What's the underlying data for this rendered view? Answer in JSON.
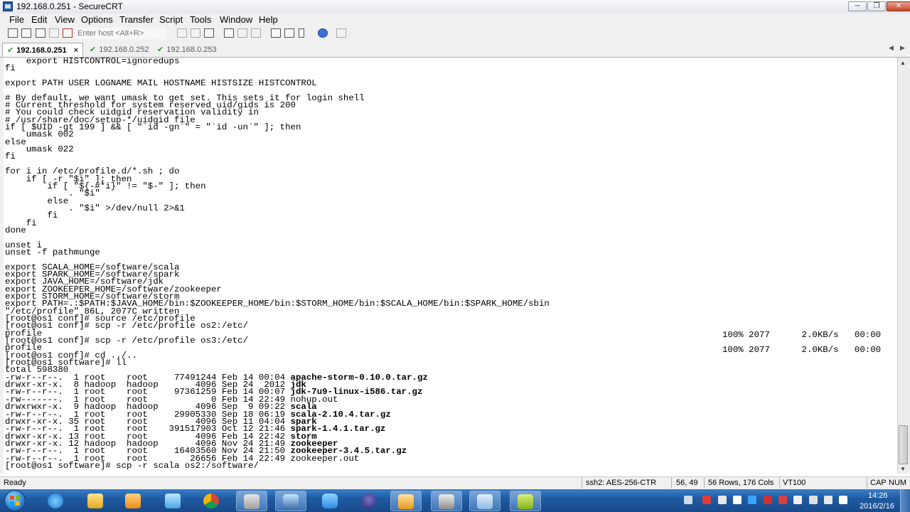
{
  "window": {
    "title": "192.168.0.251 - SecureCRT",
    "controls": {
      "minimize": "─",
      "maximize": "❐",
      "close": "✕"
    }
  },
  "menu": [
    "File",
    "Edit",
    "View",
    "Options",
    "Transfer",
    "Script",
    "Tools",
    "Window",
    "Help"
  ],
  "toolbar": {
    "quick_connect_placeholder": "Enter host <Alt+R>"
  },
  "tabs": [
    {
      "label": "192.168.0.251",
      "active": true,
      "close": "×"
    },
    {
      "label": "192.168.0.252",
      "active": false
    },
    {
      "label": "192.168.0.253",
      "active": false
    }
  ],
  "terminal": {
    "lines": [
      "    export HISTCONTROL=ignoredups",
      "fi",
      "",
      "export PATH USER LOGNAME MAIL HOSTNAME HISTSIZE HISTCONTROL",
      "",
      "# By default, we want umask to get set. This sets it for login shell",
      "# Current threshold for system reserved uid/gids is 200",
      "# You could check uidgid reservation validity in",
      "# /usr/share/doc/setup-*/uidgid file",
      "if [ $UID -gt 199 ] && [ \"`id -gn`\" = \"`id -un`\" ]; then",
      "    umask 002",
      "else",
      "    umask 022",
      "fi",
      "",
      "for i in /etc/profile.d/*.sh ; do",
      "    if [ -r \"$i\" ]; then",
      "        if [ \"${-#*i}\" != \"$-\" ]; then",
      "            . \"$i\"",
      "        else",
      "            . \"$i\" >/dev/null 2>&1",
      "        fi",
      "    fi",
      "done",
      "",
      "unset i",
      "unset -f pathmunge",
      "",
      "export SCALA_HOME=/software/scala",
      "export SPARK_HOME=/software/spark",
      "export JAVA_HOME=/software/jdk",
      "export ZOOKEEPER_HOME=/software/zookeeper",
      "export STORM_HOME=/software/storm",
      "export PATH=.:$PATH:$JAVA_HOME/bin:$ZOOKEEPER_HOME/bin:$STORM_HOME/bin:$SCALA_HOME/bin:$SPARK_HOME/sbin",
      "\"/etc/profile\" 86L, 2077C written",
      "[root@os1 conf]# source /etc/profile",
      "[root@os1 conf]# scp -r /etc/profile os2:/etc/",
      "profile",
      "[root@os1 conf]# scp -r /etc/profile os3:/etc/",
      "profile",
      "[root@os1 conf]# cd ../..",
      "[root@os1 software]# ll",
      "total 598380"
    ],
    "listing": [
      {
        "perm": "-rw-r--r--.",
        "links": " 1",
        "owner": "root   ",
        "group": "root   ",
        "size": " 77491244",
        "date": "Feb 14 00:04",
        "name": "apache-storm-0.10.0.tar.gz",
        "bold": true
      },
      {
        "perm": "drwxr-xr-x.",
        "links": " 8",
        "owner": "hadoop ",
        "group": "hadoop ",
        "size": "     4096",
        "date": "Sep 24  2012",
        "name": "jdk",
        "bold": true
      },
      {
        "perm": "-rw-r--r--.",
        "links": " 1",
        "owner": "root   ",
        "group": "root   ",
        "size": " 97361259",
        "date": "Feb 14 00:07",
        "name": "jdk-7u9-linux-i586.tar.gz",
        "bold": true
      },
      {
        "perm": "-rw-------.",
        "links": " 1",
        "owner": "root   ",
        "group": "root   ",
        "size": "        0",
        "date": "Feb 14 22:49",
        "name": "nohup.out",
        "bold": false
      },
      {
        "perm": "drwxrwxr-x.",
        "links": " 9",
        "owner": "hadoop ",
        "group": "hadoop ",
        "size": "     4096",
        "date": "Sep  9 09:22",
        "name": "scala",
        "bold": true
      },
      {
        "perm": "-rw-r--r--.",
        "links": " 1",
        "owner": "root   ",
        "group": "root   ",
        "size": " 29905330",
        "date": "Sep 18 06:19",
        "name": "scala-2.10.4.tar.gz",
        "bold": true
      },
      {
        "perm": "drwxr-xr-x.",
        "links": "35",
        "owner": "root   ",
        "group": "root   ",
        "size": "     4096",
        "date": "Sep 11 04:04",
        "name": "spark",
        "bold": true
      },
      {
        "perm": "-rw-r--r--.",
        "links": " 1",
        "owner": "root   ",
        "group": "root   ",
        "size": "391517903",
        "date": "Oct 12 21:46",
        "name": "spark-1.4.1.tar.gz",
        "bold": true
      },
      {
        "perm": "drwxr-xr-x.",
        "links": "13",
        "owner": "root   ",
        "group": "root   ",
        "size": "     4096",
        "date": "Feb 14 22:42",
        "name": "storm",
        "bold": true
      },
      {
        "perm": "drwxr-xr-x.",
        "links": "12",
        "owner": "hadoop ",
        "group": "hadoop ",
        "size": "     4096",
        "date": "Nov 24 21:49",
        "name": "zookeeper",
        "bold": true
      },
      {
        "perm": "-rw-r--r--.",
        "links": " 1",
        "owner": "root   ",
        "group": "root   ",
        "size": " 16403560",
        "date": "Nov 24 21:50",
        "name": "zookeeper-3.4.5.tar.gz",
        "bold": true
      },
      {
        "perm": "-rw-r--r--.",
        "links": " 1",
        "owner": "root   ",
        "group": "root   ",
        "size": "    26656",
        "date": "Feb 14 22:49",
        "name": "zookeeper.out",
        "bold": false
      }
    ],
    "prompt_line": "[root@os1 software]# scp -r scala os2:/software/",
    "progress": [
      "100% 2077      2.0KB/s   00:00",
      "100% 2077      2.0KB/s   00:00"
    ]
  },
  "status": {
    "ready": "Ready",
    "cipher": "ssh2: AES-256-CTR",
    "cursor": "56,  49",
    "size": "56 Rows, 176 Cols",
    "emulation": "VT100",
    "caps": "CAP",
    "num": "NUM"
  },
  "clock": {
    "time": "14:26",
    "date": "2016/2/16"
  }
}
